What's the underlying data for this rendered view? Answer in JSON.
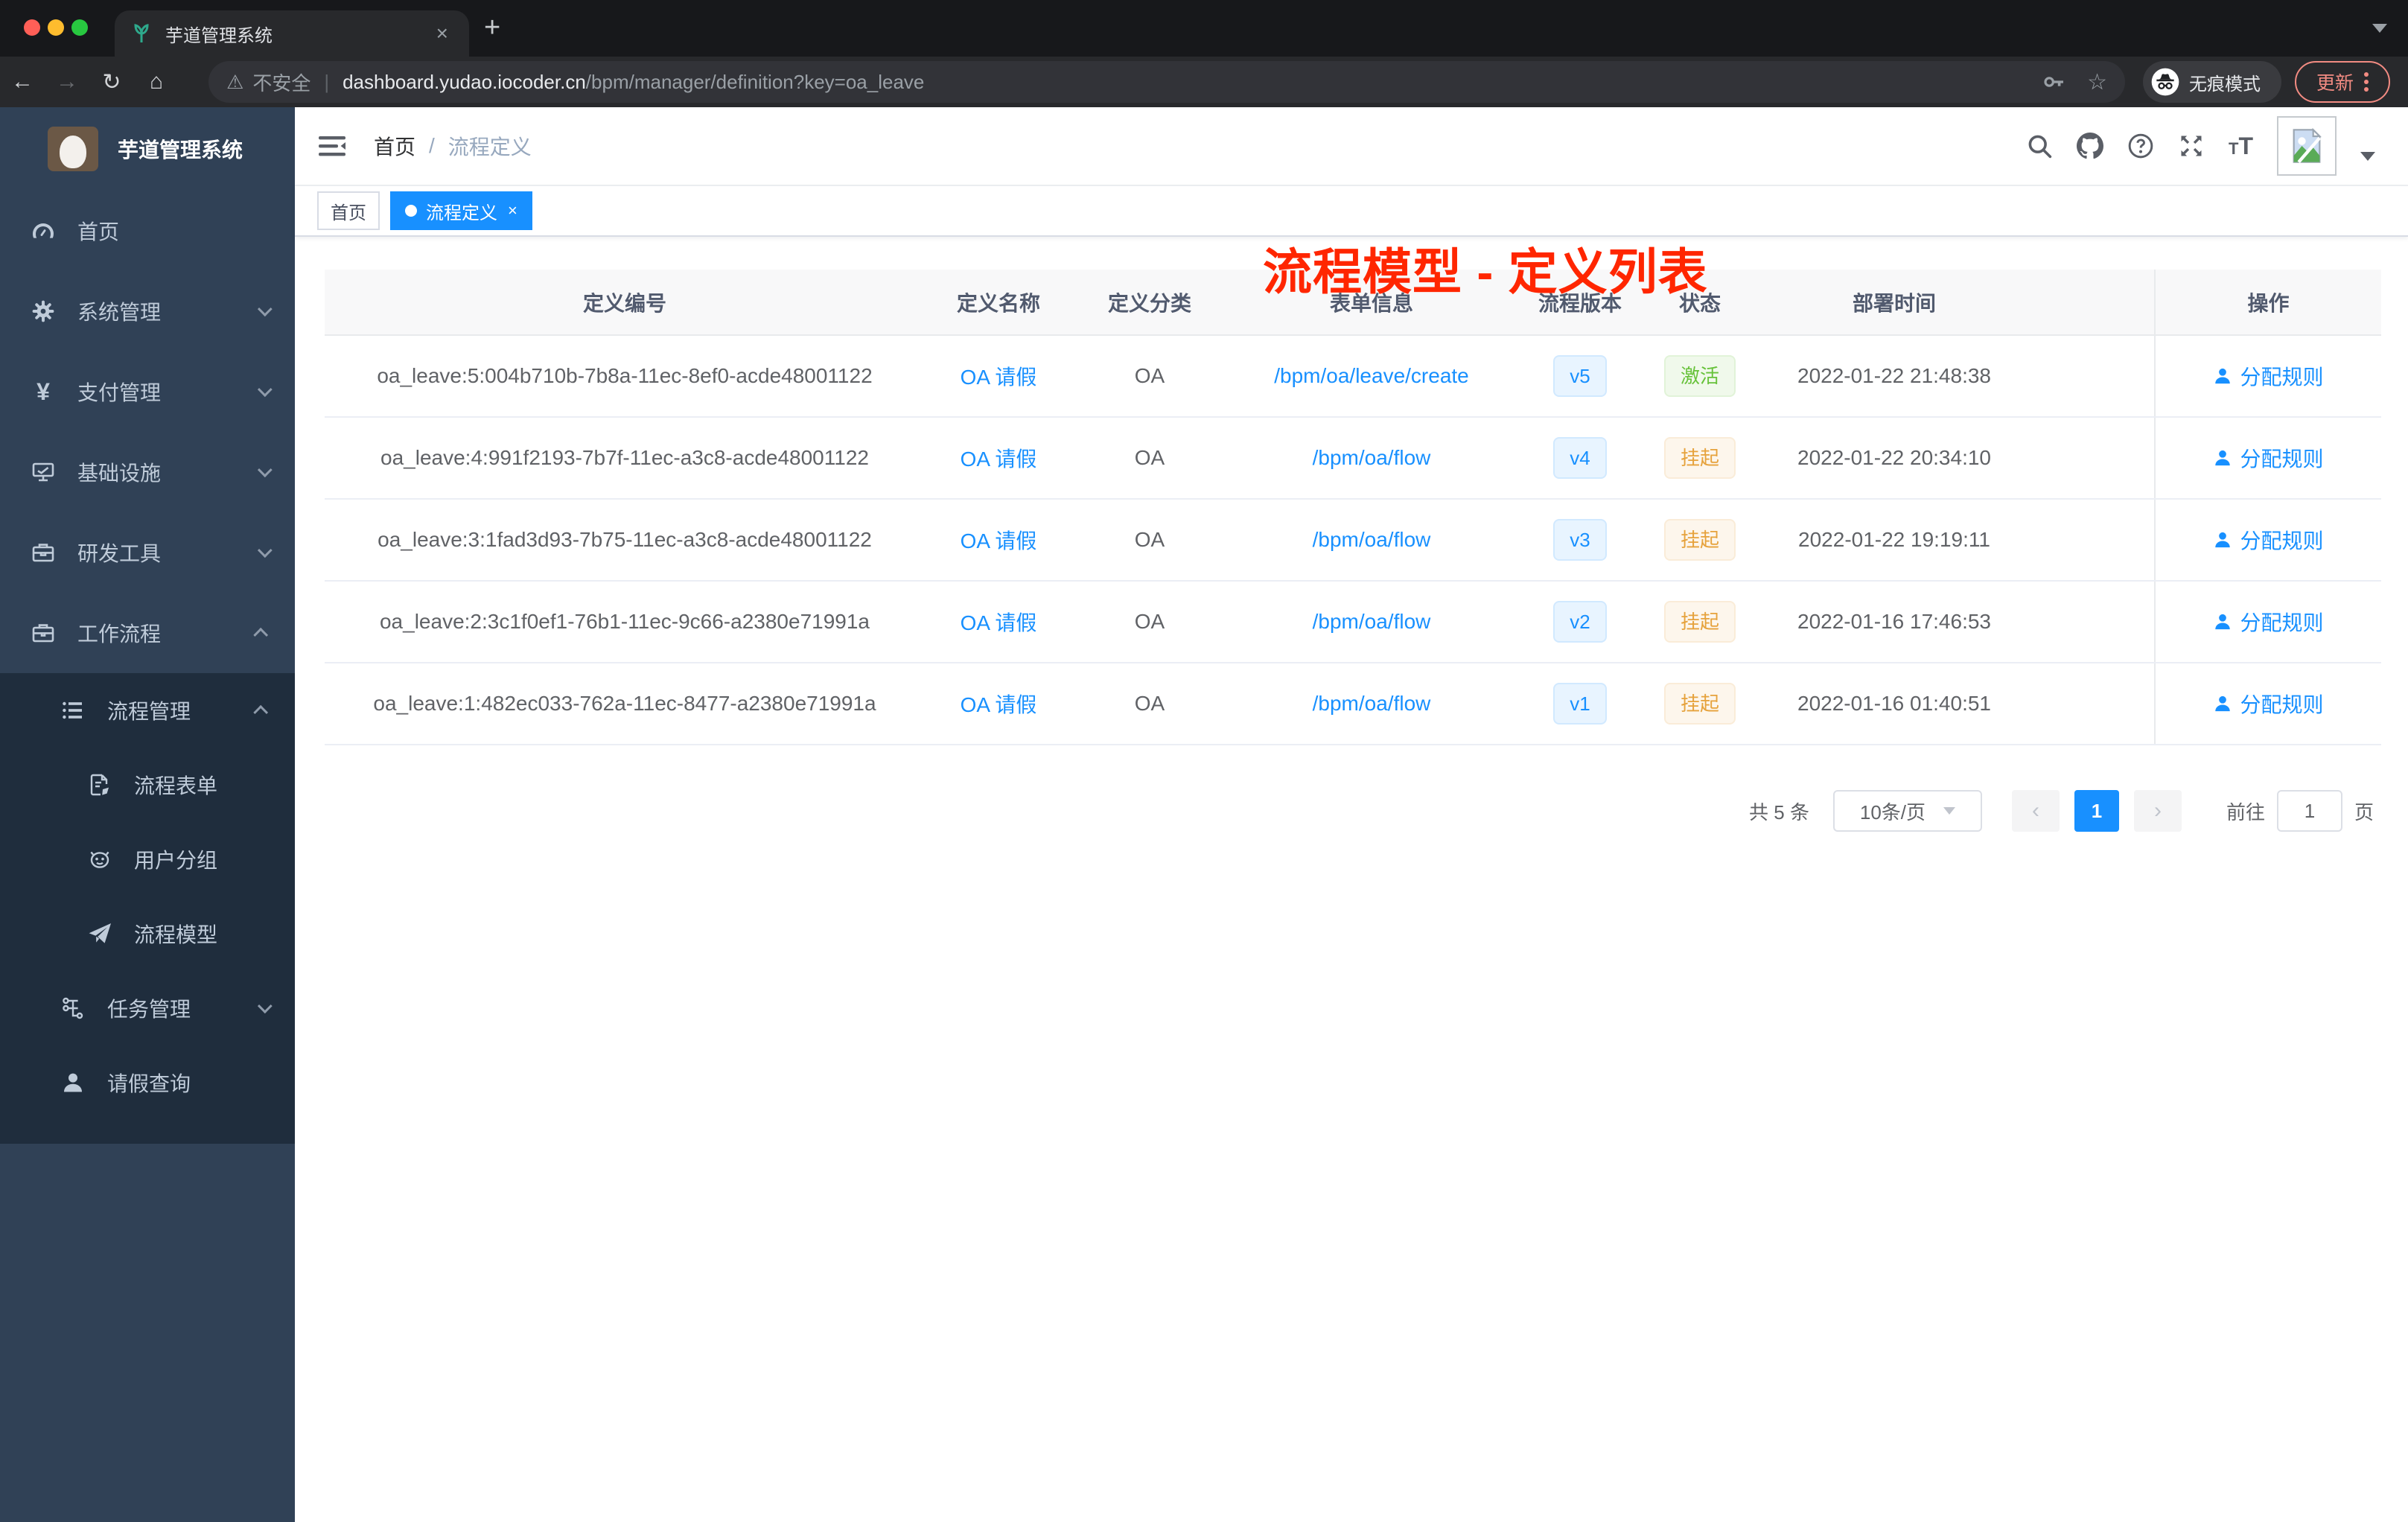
{
  "chrome": {
    "tab_title": "芋道管理系统",
    "tab_close": "×",
    "new_tab": "+",
    "back": "←",
    "forward": "→",
    "reload": "↻",
    "home": "⌂",
    "security_icon": "⚠",
    "security_label": "不安全",
    "url_host": "dashboard.yudao.iocoder.cn",
    "url_path": "/bpm/manager/definition?key=oa_leave",
    "bookmark_star": "☆",
    "incognito_label": "无痕模式",
    "update_label": "更新"
  },
  "sidebar": {
    "logo_title": "芋道管理系统",
    "menu": [
      {
        "label": "首页",
        "icon": "dashboard-icon"
      },
      {
        "label": "系统管理",
        "icon": "gear-icon"
      },
      {
        "label": "支付管理",
        "icon": "yen-icon"
      },
      {
        "label": "基础设施",
        "icon": "monitor-icon"
      },
      {
        "label": "研发工具",
        "icon": "toolbox-icon"
      },
      {
        "label": "工作流程",
        "icon": "briefcase-icon"
      }
    ],
    "submenu": [
      {
        "label": "流程管理",
        "icon": "list-icon"
      },
      {
        "label": "流程表单",
        "icon": "form-icon"
      },
      {
        "label": "用户分组",
        "icon": "robot-icon"
      },
      {
        "label": "流程模型",
        "icon": "paper-plane-icon"
      },
      {
        "label": "任务管理",
        "icon": "tree-icon"
      },
      {
        "label": "请假查询",
        "icon": "person-icon"
      }
    ],
    "yen_glyph": "¥"
  },
  "navbar": {
    "breadcrumb_home": "首页",
    "breadcrumb_sep": "/",
    "breadcrumb_current": "流程定义"
  },
  "annotation": {
    "text": "流程模型 - 定义列表",
    "color": "#ff2600"
  },
  "tags": {
    "home": "首页",
    "active": "流程定义",
    "close": "×"
  },
  "table": {
    "columns": {
      "id": "定义编号",
      "name": "定义名称",
      "category": "定义分类",
      "form": "表单信息",
      "version": "流程版本",
      "status": "状态",
      "deploy_time": "部署时间",
      "action": "操作"
    },
    "rows": [
      {
        "id": "oa_leave:5:004b710b-7b8a-11ec-8ef0-acde48001122",
        "name": "OA 请假",
        "category": "OA",
        "form": "/bpm/oa/leave/create",
        "version": "v5",
        "status": "激活",
        "status_type": "success",
        "time": "2022-01-22 21:48:38",
        "action": "分配规则"
      },
      {
        "id": "oa_leave:4:991f2193-7b7f-11ec-a3c8-acde48001122",
        "name": "OA 请假",
        "category": "OA",
        "form": "/bpm/oa/flow",
        "version": "v4",
        "status": "挂起",
        "status_type": "warning",
        "time": "2022-01-22 20:34:10",
        "action": "分配规则"
      },
      {
        "id": "oa_leave:3:1fad3d93-7b75-11ec-a3c8-acde48001122",
        "name": "OA 请假",
        "category": "OA",
        "form": "/bpm/oa/flow",
        "version": "v3",
        "status": "挂起",
        "status_type": "warning",
        "time": "2022-01-22 19:19:11",
        "action": "分配规则"
      },
      {
        "id": "oa_leave:2:3c1f0ef1-76b1-11ec-9c66-a2380e71991a",
        "name": "OA 请假",
        "category": "OA",
        "form": "/bpm/oa/flow",
        "version": "v2",
        "status": "挂起",
        "status_type": "warning",
        "time": "2022-01-16 17:46:53",
        "action": "分配规则"
      },
      {
        "id": "oa_leave:1:482ec033-762a-11ec-8477-a2380e71991a",
        "name": "OA 请假",
        "category": "OA",
        "form": "/bpm/oa/flow",
        "version": "v1",
        "status": "挂起",
        "status_type": "warning",
        "time": "2022-01-16 01:40:51",
        "action": "分配规则"
      }
    ]
  },
  "pagination": {
    "total": "共 5 条",
    "page_size": "10条/页",
    "prev": "‹",
    "page": "1",
    "next": "›",
    "goto": "前往",
    "goto_value": "1",
    "unit": "页"
  },
  "colors": {
    "primary": "#1890ff",
    "success": "#67c23a",
    "warning": "#e6a23c",
    "annotation_red": "#ff2600",
    "sidebar_bg": "#304156",
    "submenu_bg": "#1f2d3d",
    "sidebar_text": "#bfcbd9",
    "update_pill": "#f28b82"
  }
}
